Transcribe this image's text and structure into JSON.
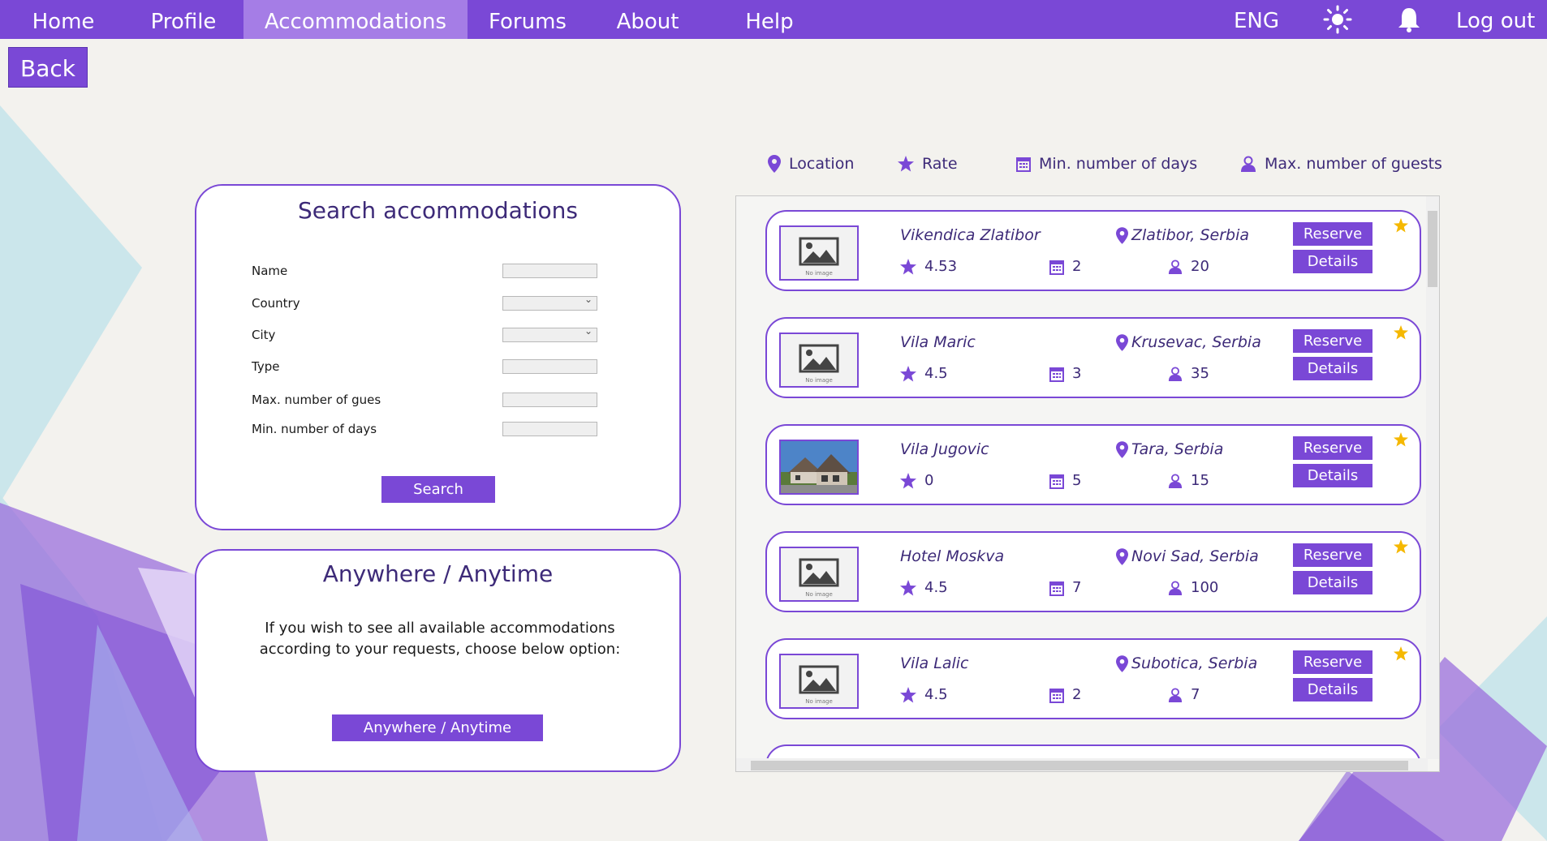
{
  "nav": {
    "items": [
      "Home",
      "Profile",
      "Accommodations",
      "Forums",
      "About",
      "Help"
    ],
    "active_index": 2,
    "language": "ENG",
    "logout": "Log out",
    "icons": [
      "sun-icon",
      "bell-icon"
    ]
  },
  "back_label": "Back",
  "search": {
    "title": "Search accommodations",
    "fields": [
      {
        "label": "Name",
        "kind": "text"
      },
      {
        "label": "Country",
        "kind": "select"
      },
      {
        "label": "City",
        "kind": "select"
      },
      {
        "label": "Type",
        "kind": "text"
      },
      {
        "label": "Max. number of gues",
        "kind": "text"
      },
      {
        "label": "Min. number of days",
        "kind": "text"
      }
    ],
    "button": "Search"
  },
  "anywhere": {
    "title": "Anywhere / Anytime",
    "text": "If you wish to see all available accommodations according to your requests, choose below option:",
    "button": "Anywhere / Anytime"
  },
  "filters": {
    "location": "Location",
    "rate": "Rate",
    "min_days": "Min. number of days",
    "max_guests": "Max. number of guests"
  },
  "accommodations": [
    {
      "name": "Vikendica Zlatibor",
      "location": "Zlatibor, Serbia",
      "rate": "4.53",
      "days": "2",
      "guests": "20",
      "image": "no-image"
    },
    {
      "name": "Vila Maric",
      "location": "Krusevac, Serbia",
      "rate": "4.5",
      "days": "3",
      "guests": "35",
      "image": "no-image"
    },
    {
      "name": "Vila Jugovic",
      "location": "Tara, Serbia",
      "rate": "0",
      "days": "5",
      "guests": "15",
      "image": "house-photo"
    },
    {
      "name": "Hotel Moskva",
      "location": "Novi Sad, Serbia",
      "rate": "4.5",
      "days": "7",
      "guests": "100",
      "image": "no-image"
    },
    {
      "name": "Vila Lalic",
      "location": "Subotica, Serbia",
      "rate": "4.5",
      "days": "2",
      "guests": "7",
      "image": "no-image"
    }
  ],
  "card_buttons": {
    "reserve": "Reserve",
    "details": "Details"
  },
  "no_image_text": "No image",
  "colors": {
    "primary": "#7a48d6",
    "active_tab": "#a57de6",
    "text_dark": "#3d2a78",
    "star": "#f5b800"
  }
}
